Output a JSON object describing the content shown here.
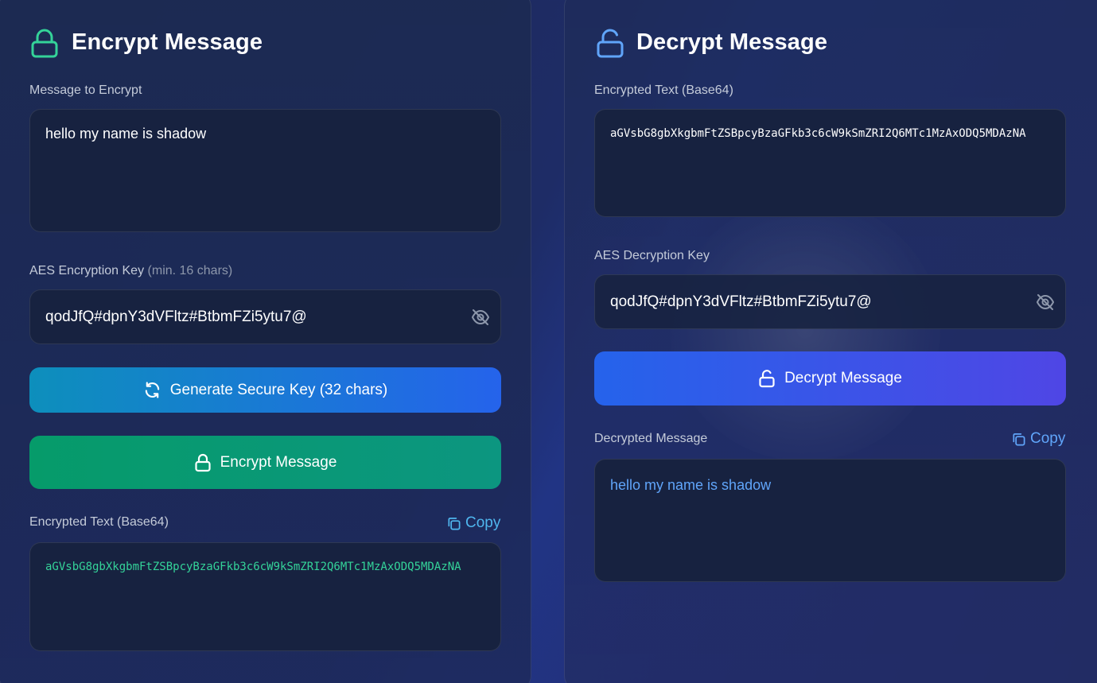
{
  "encrypt": {
    "title": "Encrypt Message",
    "message_label": "Message to Encrypt",
    "message_value": "hello my name is shadow",
    "key_label": "AES Encryption Key",
    "key_hint": "(min. 16 chars)",
    "key_value": "qodJfQ#dpnY3dVFltz#BtbmFZi5ytu7@",
    "generate_button": "Generate Secure Key (32 chars)",
    "encrypt_button": "Encrypt Message",
    "output_label": "Encrypted Text (Base64)",
    "copy_label": "Copy",
    "output_value": "aGVsbG8gbXkgbmFtZSBpcyBzaGFkb3c6cW9kSmZRI2Q6MTc1MzAxODQ5MDAzNA",
    "accent_color": "#34d399"
  },
  "decrypt": {
    "title": "Decrypt Message",
    "input_label": "Encrypted Text (Base64)",
    "input_value": "aGVsbG8gbXkgbmFtZSBpcyBzaGFkb3c6cW9kSmZRI2Q6MTc1MzAxODQ5MDAzNA",
    "key_label": "AES Decryption Key",
    "key_value": "qodJfQ#dpnY3dVFltz#BtbmFZi5ytu7@",
    "decrypt_button": "Decrypt Message",
    "output_label": "Decrypted Message",
    "copy_label": "Copy",
    "output_value": "hello my name is shadow",
    "accent_color": "#60a5fa"
  },
  "icons": {
    "encrypt_title": "lock-icon",
    "decrypt_title": "unlock-icon",
    "key_visibility": "eye-off-icon",
    "generate": "refresh-icon",
    "copy": "copy-icon"
  }
}
